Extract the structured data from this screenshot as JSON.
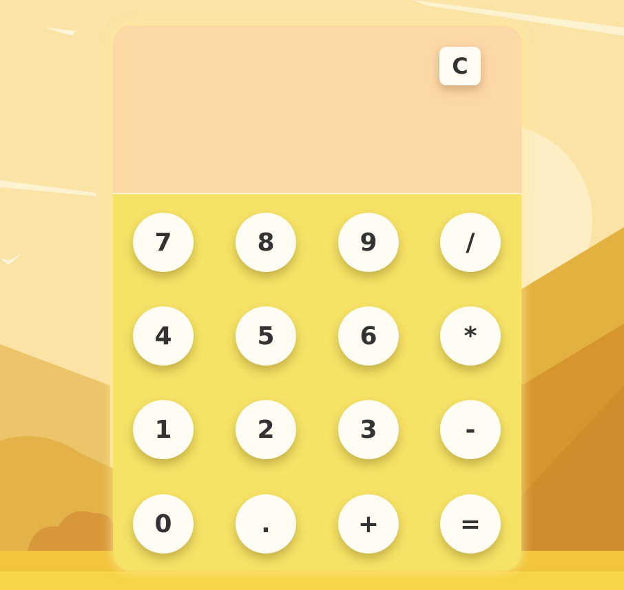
{
  "calculator": {
    "display_value": "",
    "clear_label": "C",
    "keys": [
      [
        "7",
        "8",
        "9",
        "/"
      ],
      [
        "4",
        "5",
        "6",
        "*"
      ],
      [
        "1",
        "2",
        "3",
        "-"
      ],
      [
        "0",
        ".",
        "+",
        "="
      ]
    ]
  },
  "colors": {
    "background_sky": "#fbe3a6",
    "display_bg": "#fdd8a7",
    "keypad_bg": "#f6e266",
    "key_bg": "#fffdf3",
    "key_text": "#333333",
    "ground": "#f2c53a",
    "hills": "#d99e35"
  }
}
